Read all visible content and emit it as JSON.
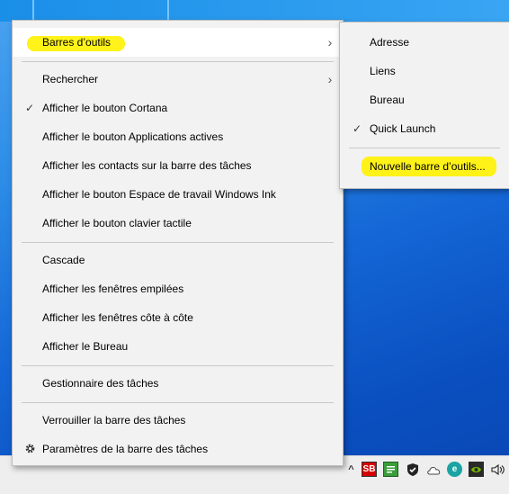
{
  "context_menu": {
    "items": [
      {
        "label": "Barres d’outils"
      },
      {
        "label": "Rechercher"
      },
      {
        "label": "Afficher le bouton Cortana"
      },
      {
        "label": "Afficher le bouton Applications actives"
      },
      {
        "label": "Afficher les contacts sur la barre des tâches"
      },
      {
        "label": "Afficher le bouton Espace de travail Windows Ink"
      },
      {
        "label": "Afficher le bouton clavier tactile"
      },
      {
        "label": "Cascade"
      },
      {
        "label": "Afficher les fenêtres empilées"
      },
      {
        "label": "Afficher les fenêtres côte à côte"
      },
      {
        "label": "Afficher le Bureau"
      },
      {
        "label": "Gestionnaire des tâches"
      },
      {
        "label": "Verrouiller la barre des tâches"
      },
      {
        "label": "Paramètres de la barre des tâches"
      }
    ],
    "checked_item": "Afficher le bouton Cortana"
  },
  "submenu": {
    "items": [
      {
        "label": "Adresse"
      },
      {
        "label": "Liens"
      },
      {
        "label": "Bureau"
      },
      {
        "label": "Quick Launch"
      },
      {
        "label": "Nouvelle barre d’outils..."
      }
    ],
    "checked_item": "Quick Launch"
  },
  "tray": {
    "icons": [
      "sb-app-icon",
      "notes-app-icon",
      "shield-check-icon",
      "onedrive-cloud-icon",
      "edge-browser-icon",
      "nvidia-icon",
      "volume-icon"
    ],
    "sb_label": "SB",
    "e_label": "e"
  },
  "colors": {
    "highlight": "#fff200",
    "menu_bg": "#f2f2f2",
    "hover_bg": "#ffffff",
    "desktop": "#1466d6",
    "taskbar": "#eeeeee"
  }
}
